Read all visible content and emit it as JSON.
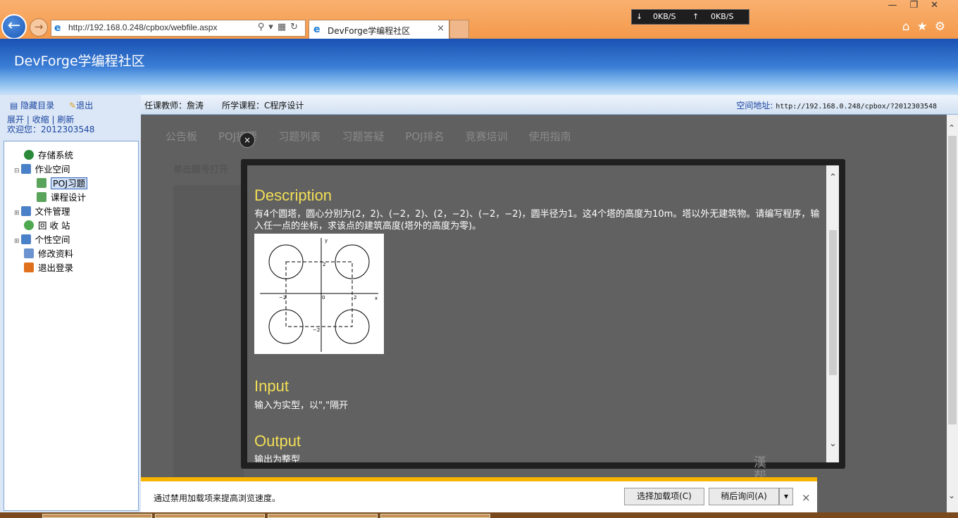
{
  "browser": {
    "url": "http://192.168.0.248/cpbox/webfile.aspx",
    "tab_title": "DevForge学编程社区",
    "tab_close": "×",
    "speed_down": "0KB/S",
    "speed_up": "0KB/S",
    "nav_icons": [
      "home-icon",
      "star-icon",
      "gear-icon"
    ],
    "window_controls": [
      "minimize",
      "restore",
      "close"
    ]
  },
  "header": {
    "site_title": "DevForge学编程社区"
  },
  "infobar": {
    "hide_menu": "隐藏目录",
    "logout": "退出",
    "teacher": "任课教师：詹涛",
    "course": "所学课程：C程序设计",
    "space_label": "空间地址:",
    "space_url": "http://192.168.0.248/cpbox/?2012303548"
  },
  "sidebar": {
    "links": "展开 | 收缩 | 刷新",
    "welcome": "欢迎您：2012303548",
    "tree": [
      {
        "label": "存储系统",
        "level": 0
      },
      {
        "label": "作业空间",
        "level": 0
      },
      {
        "label": "POJ习题",
        "level": 1,
        "selected": true
      },
      {
        "label": "课程设计",
        "level": 1
      },
      {
        "label": "文件管理",
        "level": 0
      },
      {
        "label": "回 收 站",
        "level": 0
      },
      {
        "label": "个性空间",
        "level": 0
      },
      {
        "label": "修改资料",
        "level": 0
      },
      {
        "label": "退出登录",
        "level": 0
      }
    ]
  },
  "content": {
    "menu": [
      "公告板",
      "POJ摘要",
      "习题列表",
      "习题答疑",
      "POJ排名",
      "竞赛培训",
      "使用指南"
    ],
    "title": "单击题号打开"
  },
  "modal": {
    "close": "×",
    "description_title": "Description",
    "description_text": "有4个圆塔，圆心分别为(2，2)、(−2，2)、(2，−2)、(−2，−2)，圆半径为1。这4个塔的高度为10m。塔以外无建筑物。请编写程序，输入任一点的坐标，求该点的建筑高度(塔外的高度为零)。",
    "input_title": "Input",
    "input_text": "输入为实型，以\",\"隔开",
    "output_title": "Output",
    "output_text": "输出为整型",
    "figure": {
      "x_label": "x",
      "y_label": "y",
      "origin": "0",
      "tick_pos": "2",
      "tick_neg": "−2"
    }
  },
  "notification": {
    "text": "通过禁用加载项来提高浏览速度。",
    "choose_addons": "选择加载项(C)",
    "ask_later": "稍后询问(A)",
    "close": "×"
  },
  "watermark": "漢\n帮"
}
